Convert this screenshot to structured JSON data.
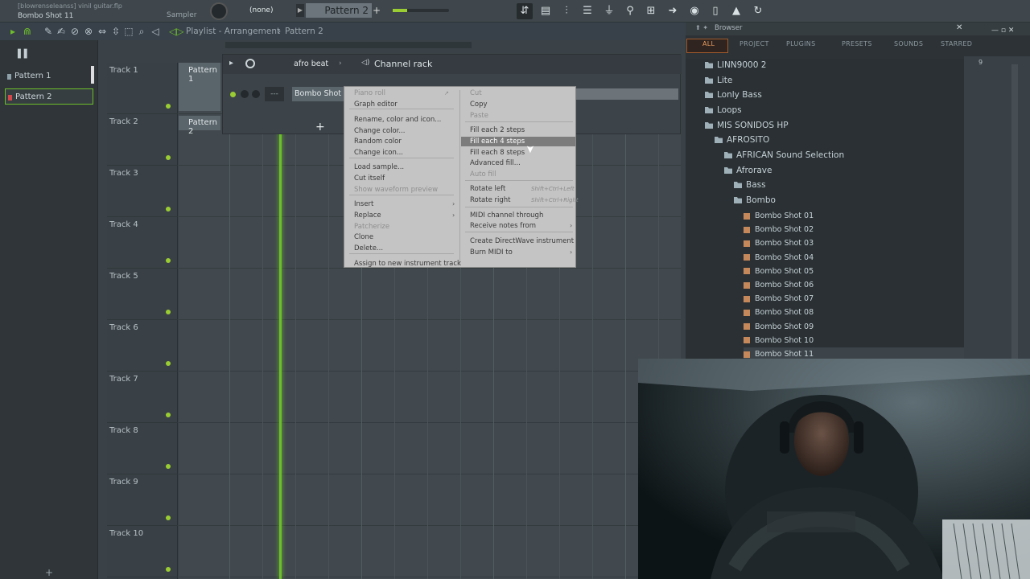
{
  "top": {
    "project_line": "[blowrenseleanss] vinil guitar.flp",
    "channel_name": "Bombo Shot 11",
    "sampler_label": "Sampler",
    "none_label": "(none)",
    "pattern_label": "Pattern 2"
  },
  "playlist": {
    "breadcrumb": "Playlist - Arrangement",
    "pattern": "Pattern 2",
    "arrow": "›"
  },
  "patterns": [
    {
      "label": "Pattern 1"
    },
    {
      "label": "Pattern 2"
    }
  ],
  "tracks": [
    "Track 1",
    "Track 2",
    "Track 3",
    "Track 4",
    "Track 5",
    "Track 6",
    "Track 7",
    "Track 8",
    "Track 9",
    "Track 10"
  ],
  "clips": {
    "c1": "Pattern 1",
    "c2": "Pattern 2"
  },
  "channel_rack": {
    "filter": "afro beat",
    "title": "Channel rack",
    "channel": "Bombo Shot 11",
    "dash": "---"
  },
  "menu_left": [
    {
      "label": "Piano roll",
      "dis": true
    },
    {
      "label": "Graph editor",
      "dis": false
    },
    {
      "label": "Rename, color and icon...",
      "dis": false
    },
    {
      "label": "Change color...",
      "dis": false
    },
    {
      "label": "Random color",
      "dis": false
    },
    {
      "label": "Change icon...",
      "dis": false
    },
    {
      "label": "Load sample...",
      "dis": false
    },
    {
      "label": "Cut itself",
      "dis": false
    },
    {
      "label": "Show waveform preview",
      "dis": true
    },
    {
      "label": "Insert",
      "dis": false
    },
    {
      "label": "Replace",
      "dis": false
    },
    {
      "label": "Patcherize",
      "dis": true
    },
    {
      "label": "Clone",
      "dis": false
    },
    {
      "label": "Delete...",
      "dis": false
    },
    {
      "label": "Assign to new instrument track",
      "dis": false
    }
  ],
  "menu_right": [
    {
      "label": "Cut",
      "dis": true
    },
    {
      "label": "Copy",
      "dis": false
    },
    {
      "label": "Paste",
      "dis": true
    },
    {
      "label": "Fill each 2 steps",
      "dis": false
    },
    {
      "label": "Fill each 4 steps",
      "dis": false
    },
    {
      "label": "Fill each 8 steps",
      "dis": false
    },
    {
      "label": "Advanced fill...",
      "dis": false
    },
    {
      "label": "Auto fill",
      "dis": true
    },
    {
      "label": "Rotate left",
      "dis": false
    },
    {
      "label": "Rotate right",
      "dis": false
    },
    {
      "label": "MIDI channel through",
      "dis": false
    },
    {
      "label": "Receive notes from",
      "dis": false
    },
    {
      "label": "Create DirectWave instrument",
      "dis": false
    },
    {
      "label": "Burn MIDI to",
      "dis": false
    }
  ],
  "shortcuts": {
    "rotate_left": "Shift+Ctrl+Left",
    "rotate_right": "Shift+Ctrl+Right",
    "piano": "↗"
  },
  "browser": {
    "title": "Browser",
    "tabs": [
      "ALL",
      "PROJECT",
      "PLUGINS",
      "PRESETS",
      "SOUNDS",
      "STARRED"
    ],
    "folders": [
      "LINN9000 2",
      "Lite",
      "Lonly Bass",
      "Loops",
      "MIS SONIDOS HP",
      "AFROSITO",
      "AFRICAN Sound Selection",
      "Afrorave",
      "Bass",
      "Bombo"
    ],
    "files": [
      "Bombo Shot 01",
      "Bombo Shot 02",
      "Bombo Shot 03",
      "Bombo Shot 04",
      "Bombo Shot 05",
      "Bombo Shot 06",
      "Bombo Shot 07",
      "Bombo Shot 08",
      "Bombo Shot 09",
      "Bombo Shot 10",
      "Bombo Shot 11"
    ],
    "side_num": "9"
  },
  "colors": {
    "accent": "#6dbf2a",
    "highlight": "#7c7c7c"
  }
}
